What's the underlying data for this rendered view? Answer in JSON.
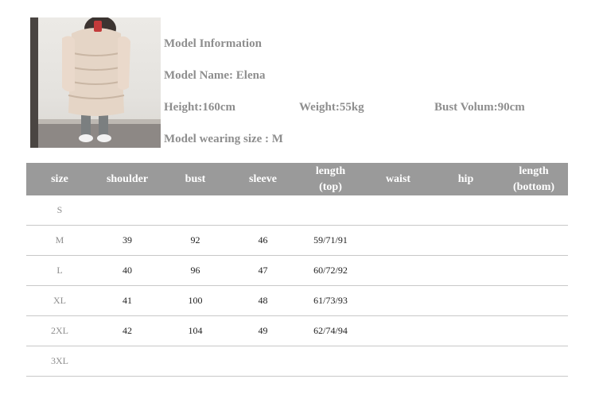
{
  "model": {
    "heading": "Model Information",
    "name": "Model Name: Elena",
    "height": "Height:160cm",
    "weight": "Weight:55kg",
    "bust": "Bust Volum:90cm",
    "size": "Model wearing size : M"
  },
  "table": {
    "headers": [
      "size",
      "shoulder",
      "bust",
      "sleeve",
      "length\n(top)",
      "waist",
      "hip",
      "length\n(bottom)"
    ],
    "rows": [
      [
        "S",
        "",
        "",
        "",
        "",
        "",
        "",
        ""
      ],
      [
        "M",
        "39",
        "92",
        "46",
        "59/71/91",
        "",
        "",
        ""
      ],
      [
        "L",
        "40",
        "96",
        "47",
        "60/72/92",
        "",
        "",
        ""
      ],
      [
        "XL",
        "41",
        "100",
        "48",
        "61/73/93",
        "",
        "",
        ""
      ],
      [
        "2XL",
        "42",
        "104",
        "49",
        "62/74/94",
        "",
        "",
        ""
      ],
      [
        "3XL",
        "",
        "",
        "",
        "",
        "",
        "",
        ""
      ]
    ]
  },
  "colors": {
    "header_bg": "#9a9a9a",
    "info_text": "#8e8e8e",
    "row_divider": "#c8c8c8"
  }
}
